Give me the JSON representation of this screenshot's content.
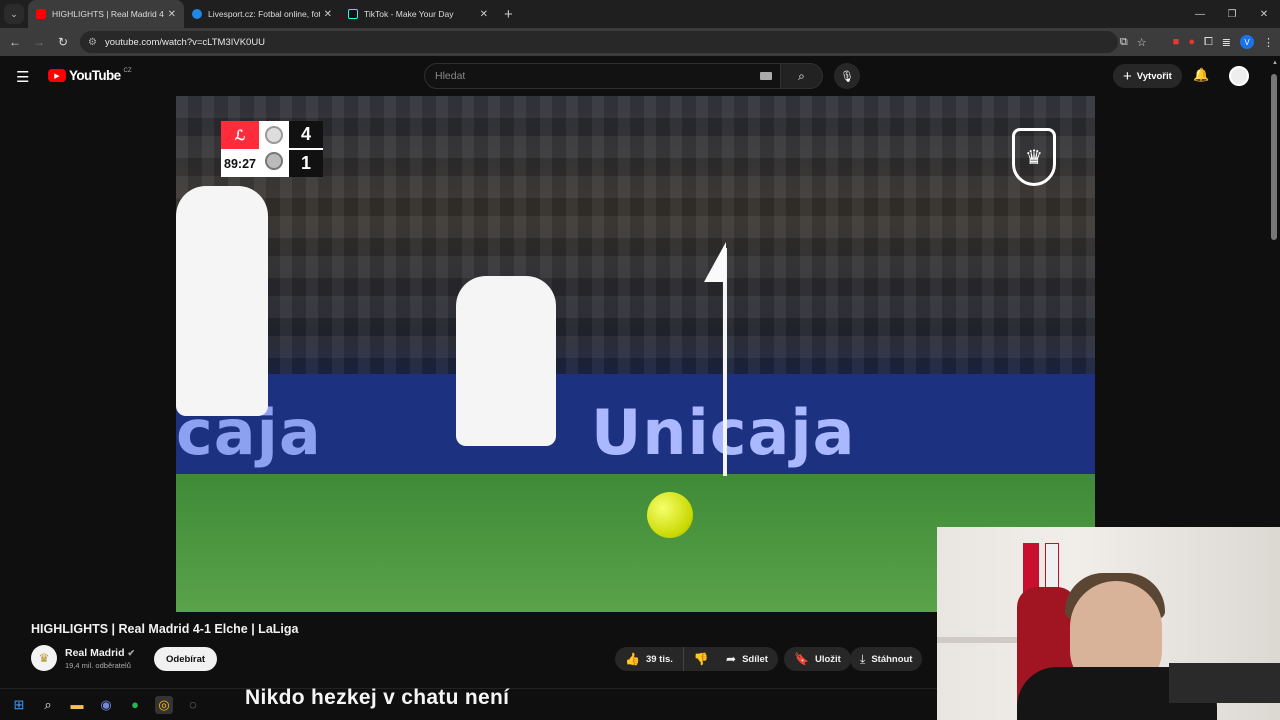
{
  "browser": {
    "tabs": [
      {
        "title": "HIGHLIGHTS | Real Madrid 4-1",
        "active": true
      },
      {
        "title": "Livesport.cz: Fotbal online, fotb",
        "active": false
      },
      {
        "title": "TikTok - Make Your Day",
        "active": false
      }
    ],
    "url": "youtube.com/watch?v=cLTM3IVK0UU"
  },
  "youtube": {
    "logo_text": "YouTube",
    "country": "CZ",
    "search_placeholder": "Hledat",
    "create_label": "Vytvořit"
  },
  "scoreboard": {
    "time": "89:27",
    "home_goals": "4",
    "away_goals": "1"
  },
  "video_board_text": "Unicaja",
  "video_board_left": "caja",
  "video": {
    "title": "HIGHLIGHTS | Real Madrid 4-1 Elche | LaLiga",
    "channel": "Real Madrid",
    "subscribers": "19,4 mil. odběratelů",
    "subscribe_label": "Odebírat",
    "likes": "39 tis.",
    "share_label": "Sdílet",
    "save_label": "Uložit",
    "download_label": "Stáhnout"
  },
  "overlay_caption": "Nikdo hezkej v chatu není"
}
